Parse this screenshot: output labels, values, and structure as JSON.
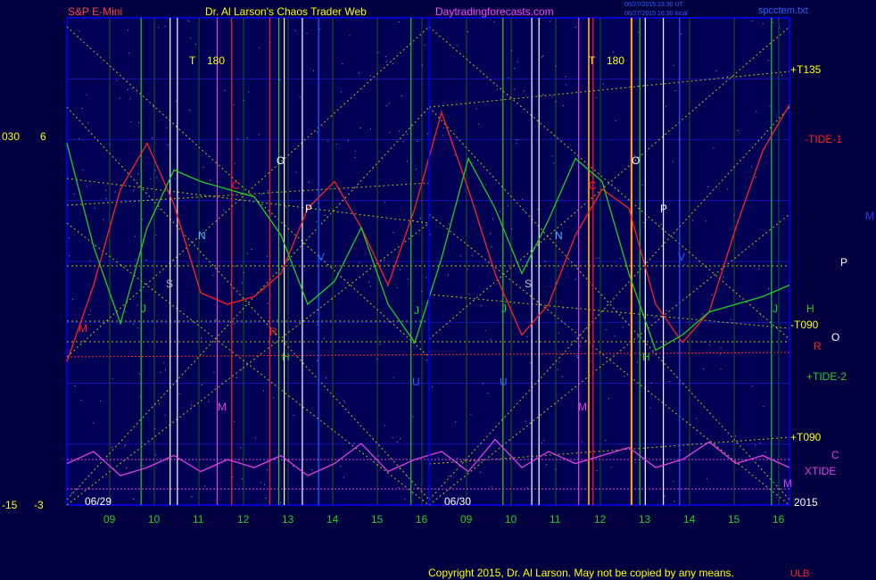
{
  "header": {
    "left_title": "S&P E-Mini",
    "center_title": "Dr. Al Larson's Chaos Trader Web",
    "site": "Daytradingforecasts.com",
    "stamp1": "06/27/2015 23:30 UT",
    "stamp2": "06/27/2015 16:30 local",
    "file": "spcctem.txt"
  },
  "footer": {
    "copyright": "Copyright 2015, Dr. Al Larson. May not be copied by any means.",
    "corner": "ULB"
  },
  "colors": {
    "background": "#000040",
    "frame": "#0000ff",
    "tide": "#ff2020",
    "tide2": "#20d020",
    "xtide": "#e040e0",
    "trendline": "#e0e000",
    "text_yellow": "#ffff00",
    "header_red": "#ff4040",
    "header_magenta": "#ff40ff"
  },
  "chart_data": {
    "type": "line",
    "title": "S&P E-Mini",
    "left_axis": {
      "labels_upper": [
        "030",
        "6"
      ],
      "labels_lower": [
        "-15",
        "-3"
      ]
    },
    "date_labels": [
      "06/29",
      "06/30"
    ],
    "year_label": "2015",
    "x_ticks": [
      "09",
      "10",
      "11",
      "12",
      "13",
      "14",
      "15",
      "16",
      "09",
      "10",
      "11",
      "12",
      "13",
      "14",
      "15",
      "16"
    ],
    "right_labels": [
      {
        "text": "+T135",
        "color": "#ffff00"
      },
      {
        "text": "-TIDE-1",
        "color": "#ff2020"
      },
      {
        "text": "M",
        "color": "#3030ff"
      },
      {
        "text": "P",
        "color": "#ffffff"
      },
      {
        "text": "H",
        "color": "#20d020"
      },
      {
        "text": "-T090",
        "color": "#ffff00"
      },
      {
        "text": "O",
        "color": "#ffffff"
      },
      {
        "text": "R",
        "color": "#ff2020"
      },
      {
        "text": "+TIDE-2",
        "color": "#20d020"
      },
      {
        "text": "+T090",
        "color": "#ffff00"
      },
      {
        "text": "C",
        "color": "#e040e0"
      },
      {
        "text": "XTIDE",
        "color": "#e040e0"
      }
    ],
    "vline_labels": [
      {
        "text": "T",
        "color": "#ffff00"
      },
      {
        "text": "180",
        "color": "#ffff00"
      },
      {
        "text": "C",
        "color": "#ff2020"
      },
      {
        "text": "O",
        "color": "#ffffff"
      },
      {
        "text": "P",
        "color": "#ffffff"
      },
      {
        "text": "N",
        "color": "#40c0ff"
      },
      {
        "text": "S",
        "color": "#c0c0c0"
      },
      {
        "text": "J",
        "color": "#20d020"
      },
      {
        "text": "M",
        "color": "#e040e0"
      },
      {
        "text": "H",
        "color": "#20d020"
      },
      {
        "text": "R",
        "color": "#ff2020"
      },
      {
        "text": "V",
        "color": "#3060ff"
      },
      {
        "text": "M",
        "color": "#ff2020"
      },
      {
        "text": "J",
        "color": "#20d020"
      },
      {
        "text": "U",
        "color": "#3060ff"
      },
      {
        "text": "T",
        "color": "#ffff00"
      },
      {
        "text": "180",
        "color": "#ffff00"
      },
      {
        "text": "C",
        "color": "#ff2020"
      },
      {
        "text": "O",
        "color": "#ffffff"
      },
      {
        "text": "P",
        "color": "#ffffff"
      },
      {
        "text": "N",
        "color": "#40c0ff"
      },
      {
        "text": "S",
        "color": "#c0c0c0"
      },
      {
        "text": "J",
        "color": "#20d020"
      },
      {
        "text": "M",
        "color": "#e040e0"
      },
      {
        "text": "H",
        "color": "#20d020"
      },
      {
        "text": "V",
        "color": "#3060ff"
      },
      {
        "text": "U",
        "color": "#3060ff"
      },
      {
        "text": "J",
        "color": "#20d020"
      },
      {
        "text": "M",
        "color": "#e040e0"
      }
    ],
    "series": [
      {
        "name": "-TIDE-1",
        "values": [
          0.15,
          0.35,
          0.6,
          0.72,
          0.56,
          0.33,
          0.3,
          0.32,
          0.38,
          0.55,
          0.62,
          0.5,
          0.35,
          0.55,
          0.8,
          0.6,
          0.38,
          0.22,
          0.3,
          0.48,
          0.6,
          0.55,
          0.3,
          0.2,
          0.28,
          0.5,
          0.7,
          0.82
        ]
      },
      {
        "name": "+TIDE-2",
        "values": [
          0.72,
          0.45,
          0.25,
          0.5,
          0.65,
          0.62,
          0.6,
          0.58,
          0.48,
          0.3,
          0.36,
          0.5,
          0.3,
          0.2,
          0.42,
          0.68,
          0.55,
          0.38,
          0.52,
          0.68,
          0.62,
          0.38,
          0.18,
          0.22,
          0.28,
          0.3,
          0.32,
          0.35
        ]
      },
      {
        "name": "XTIDE",
        "values": [
          0.45,
          0.6,
          0.3,
          0.4,
          0.55,
          0.35,
          0.5,
          0.4,
          0.55,
          0.3,
          0.45,
          0.7,
          0.35,
          0.5,
          0.6,
          0.35,
          0.75,
          0.4,
          0.6,
          0.45,
          0.55,
          0.65,
          0.4,
          0.5,
          0.72,
          0.45,
          0.55,
          0.4
        ]
      }
    ]
  }
}
